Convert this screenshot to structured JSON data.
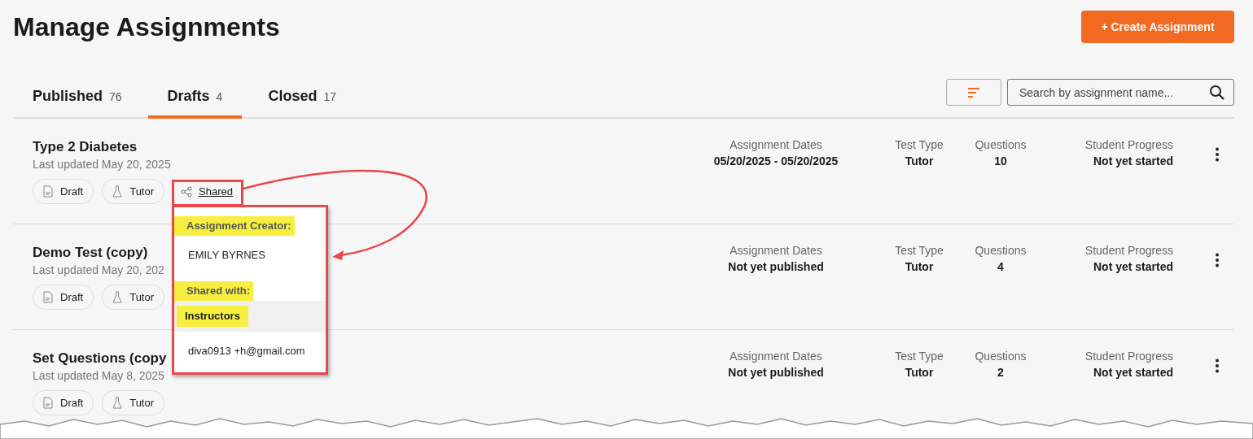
{
  "page": {
    "title": "Manage Assignments",
    "create_button": "+ Create Assignment"
  },
  "tabs": [
    {
      "label": "Published",
      "count": "76",
      "selected": false
    },
    {
      "label": "Drafts",
      "count": "4",
      "selected": true
    },
    {
      "label": "Closed",
      "count": "17",
      "selected": false
    }
  ],
  "search": {
    "placeholder": "Search by assignment name..."
  },
  "assignments": [
    {
      "labels": [
        "Assignment Dates",
        "Test Type",
        "Questions",
        "Student Progress"
      ],
      "title": "Type 2 Diabetes",
      "updated": "Last updated May 20, 2025",
      "status_chip": "Draft",
      "type_chip": "Tutor",
      "shared_link": "Shared",
      "dates": "05/20/2025 - 05/20/2025",
      "test_type": "Tutor",
      "questions": "10",
      "progress": "Not yet started"
    },
    {
      "labels": [
        "Assignment Dates",
        "Test Type",
        "Questions",
        "Student Progress"
      ],
      "title": "Demo Test (copy)",
      "updated": "Last updated May 20, 202",
      "status_chip": "Draft",
      "type_chip": "Tutor",
      "dates": "Not yet published",
      "test_type": "Tutor",
      "questions": "4",
      "progress": "Not yet started"
    },
    {
      "labels": [
        "Assignment Dates",
        "Test Type",
        "Questions",
        "Student Progress"
      ],
      "title": "Set Questions (copy",
      "updated": "Last updated May 8, 2025",
      "status_chip": "Draft",
      "type_chip": "Tutor",
      "dates": "Not yet published",
      "test_type": "Tutor",
      "questions": "2",
      "progress": "Not yet started"
    }
  ],
  "share_popup": {
    "items": [
      {
        "kind": "heading",
        "text": "Assignment Creator:",
        "highlighted": true
      },
      {
        "kind": "value",
        "text": "EMILY BYRNES",
        "highlighted": false
      },
      {
        "kind": "heading",
        "text": "Shared with:",
        "highlighted": true
      },
      {
        "kind": "group",
        "text": "Instructors",
        "highlighted": true
      },
      {
        "kind": "value",
        "text": "diva0913 +h@gmail.com",
        "highlighted": false
      }
    ]
  }
}
